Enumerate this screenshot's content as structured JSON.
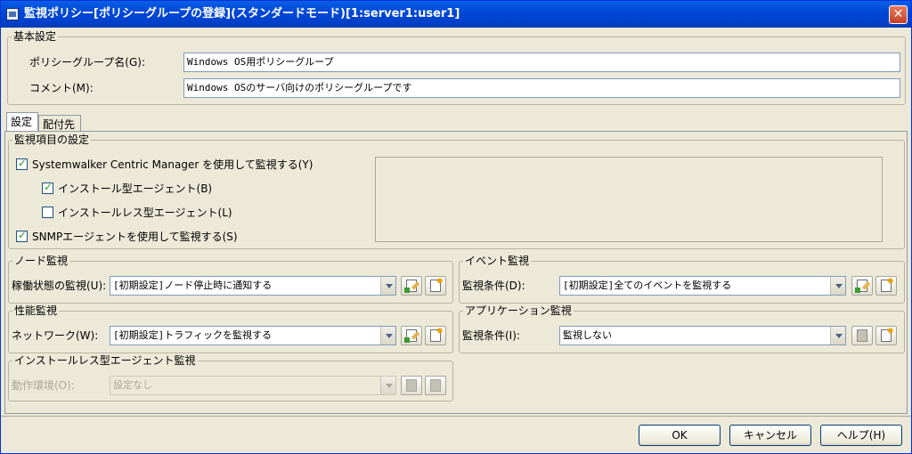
{
  "window": {
    "title": "監視ポリシー[ポリシーグループの登録](スタンダードモード)[1:server1:user1]",
    "close_glyph": "✕"
  },
  "basic": {
    "group_title": "基本設定",
    "policy_group_label": "ポリシーグループ名(G):",
    "policy_group_value": "Windows OS用ポリシーグループ",
    "comment_label": "コメント(M):",
    "comment_value": "Windows OSのサーバ向けのポリシーグループです"
  },
  "tabs": [
    {
      "label": "設定"
    },
    {
      "label": "配付先"
    }
  ],
  "monitor_items": {
    "group_title": "監視項目の設定",
    "systemwalker_label": "Systemwalker Centric Manager を使用して監視する(Y)",
    "systemwalker_checked": true,
    "install_agent_label": "インストール型エージェント(B)",
    "install_agent_checked": true,
    "installless_agent_label": "インストールレス型エージェント(L)",
    "installless_agent_checked": false,
    "snmp_label": "SNMPエージェントを使用して監視する(S)",
    "snmp_checked": true
  },
  "node_monitor": {
    "group_title": "ノード監視",
    "label": "稼働状態の監視(U):",
    "value": "[初期設定]ノード停止時に通知する"
  },
  "event_monitor": {
    "group_title": "イベント監視",
    "label": "監視条件(D):",
    "value": "[初期設定]全てのイベントを監視する"
  },
  "perf_monitor": {
    "group_title": "性能監視",
    "label": "ネットワーク(W):",
    "value": "[初期設定]トラフィックを監視する"
  },
  "app_monitor": {
    "group_title": "アプリケーション監視",
    "label": "監視条件(I):",
    "value": "監視しない"
  },
  "installless_monitor": {
    "group_title": "インストールレス型エージェント監視",
    "label": "動作環境(O):",
    "value": "設定なし"
  },
  "buttons": {
    "ok": "OK",
    "cancel": "キャンセル",
    "help": "ヘルプ(H)"
  },
  "icons": {
    "edit": "edit-icon",
    "new": "new-icon"
  }
}
